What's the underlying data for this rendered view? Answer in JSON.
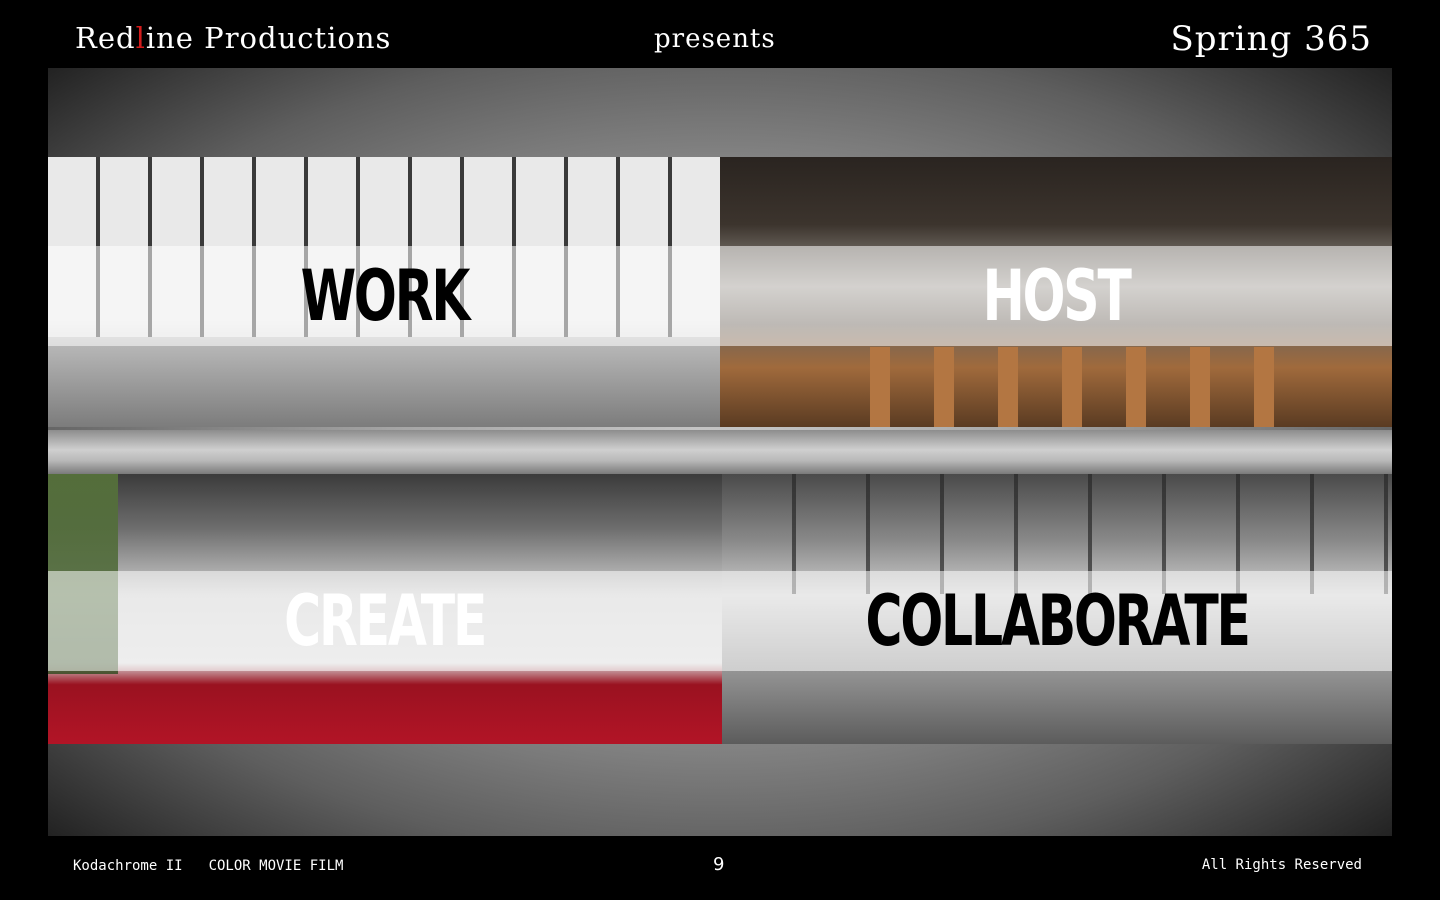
{
  "header": {
    "brand_prefix": "Red",
    "brand_highlight": "l",
    "brand_suffix": "ine Productions",
    "presents": "presents",
    "season": "Spring 365"
  },
  "tiles": [
    {
      "label": "WORK"
    },
    {
      "label": "HOST"
    },
    {
      "label": "CREATE"
    },
    {
      "label": "COLLABORATE"
    }
  ],
  "footer": {
    "film_name": "Kodachrome II",
    "film_type": "COLOR MOVIE FILM",
    "page_number": "9",
    "rights": "All Rights Reserved"
  },
  "colors": {
    "background": "#000000",
    "accent_red": "#d41b1b",
    "text": "#ffffff"
  }
}
